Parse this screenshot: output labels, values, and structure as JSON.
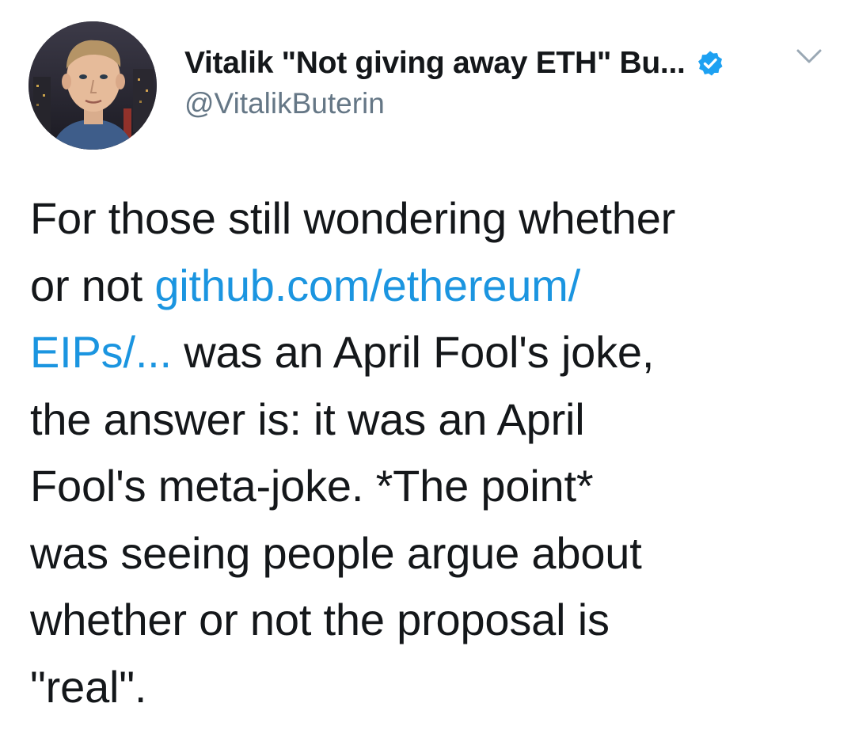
{
  "user": {
    "display_name": "Vitalik \"Not giving away ETH\" Bu...",
    "handle": "@VitalikButerin",
    "verified": true
  },
  "tweet": {
    "lines": [
      "For those still wondering whether",
      "or not ",
      "was an April Fool's joke,",
      "the answer is: it was an April",
      "Fool's meta-joke. *The point*",
      "was seeing people argue about",
      "whether or not the proposal is",
      "\"real\"."
    ],
    "link_part1": "github.com/ethereum/",
    "link_part2": "EIPs/..."
  },
  "colors": {
    "text": "#14171a",
    "secondary": "#657786",
    "link": "#1b95e0",
    "verified_badge": "#1da1f2"
  },
  "icons": {
    "verified": "verified-badge-icon",
    "more": "chevron-down-icon"
  }
}
